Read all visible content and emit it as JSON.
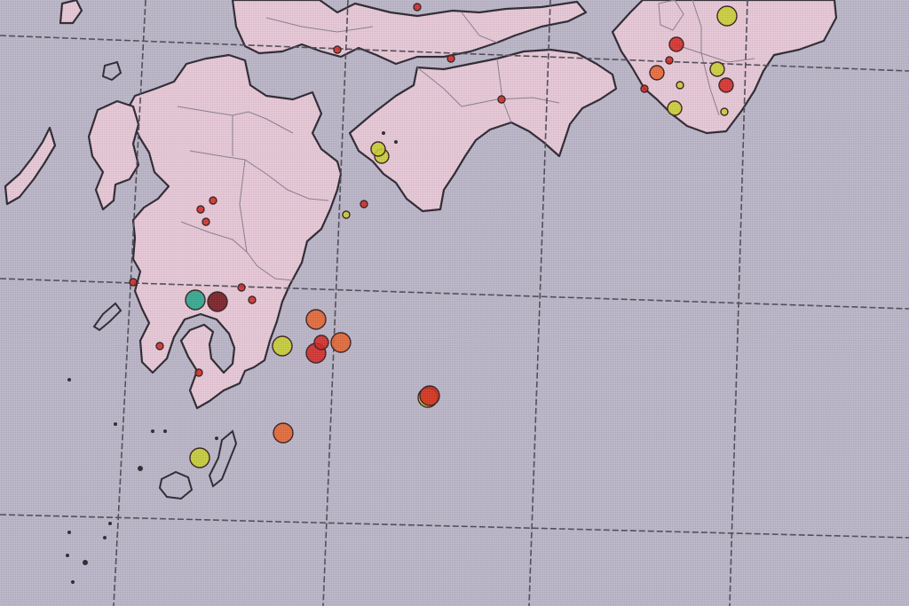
{
  "map": {
    "colors": {
      "sea": "#bcb7c9",
      "land": "#e9c9d8",
      "coast": "#2b2630",
      "grid": "#4e4a58",
      "quake_red": "#d6231e",
      "quake_orange": "#e8622a",
      "quake_yellow": "#c9d12a",
      "quake_cyan": "#1fa68a",
      "quake_darkred": "#6e0c12"
    },
    "markers": [
      {
        "id": "m1",
        "color": "quake_yellow",
        "size": "large"
      },
      {
        "id": "m2",
        "color": "quake_red",
        "size": "small"
      },
      {
        "id": "m3",
        "color": "quake_red",
        "size": "small"
      },
      {
        "id": "m4",
        "color": "quake_yellow",
        "size": "small"
      },
      {
        "id": "m5",
        "color": "quake_red",
        "size": "medium"
      },
      {
        "id": "m6",
        "color": "quake_yellow",
        "size": "medium"
      },
      {
        "id": "m7",
        "color": "quake_red",
        "size": "medium"
      },
      {
        "id": "m8",
        "color": "quake_orange",
        "size": "medium"
      },
      {
        "id": "m9",
        "color": "quake_yellow",
        "size": "medium"
      },
      {
        "id": "m10",
        "color": "quake_yellow",
        "size": "small"
      },
      {
        "id": "m11",
        "color": "quake_red",
        "size": "small"
      },
      {
        "id": "m12",
        "color": "quake_red",
        "size": "small"
      },
      {
        "id": "m13",
        "color": "quake_yellow",
        "size": "medium"
      },
      {
        "id": "m14",
        "color": "quake_yellow",
        "size": "medium"
      },
      {
        "id": "m15",
        "color": "quake_yellow",
        "size": "small"
      },
      {
        "id": "m16",
        "color": "quake_red",
        "size": "small"
      },
      {
        "id": "m17",
        "color": "quake_red",
        "size": "small"
      },
      {
        "id": "m18",
        "color": "quake_red",
        "size": "small"
      },
      {
        "id": "m19",
        "color": "quake_red",
        "size": "small"
      },
      {
        "id": "m20",
        "color": "quake_red",
        "size": "small"
      },
      {
        "id": "m21",
        "color": "quake_red",
        "size": "small"
      },
      {
        "id": "m22",
        "color": "quake_cyan",
        "size": "large"
      },
      {
        "id": "m23",
        "color": "quake_darkred",
        "size": "large"
      },
      {
        "id": "m24",
        "color": "quake_red",
        "size": "small"
      },
      {
        "id": "m25",
        "color": "quake_red",
        "size": "small"
      },
      {
        "id": "m26",
        "color": "quake_orange",
        "size": "large"
      },
      {
        "id": "m27",
        "color": "quake_red",
        "size": "large"
      },
      {
        "id": "m28",
        "color": "quake_red",
        "size": "medium"
      },
      {
        "id": "m29",
        "color": "quake_yellow",
        "size": "large"
      },
      {
        "id": "m30",
        "color": "quake_orange",
        "size": "large"
      },
      {
        "id": "m31",
        "color": "quake_yellow",
        "size": "large"
      },
      {
        "id": "m32",
        "color": "quake_red",
        "size": "large"
      },
      {
        "id": "m33",
        "color": "quake_orange",
        "size": "large"
      },
      {
        "id": "m34",
        "color": "quake_yellow",
        "size": "large"
      },
      {
        "id": "m35",
        "color": "quake_red",
        "size": "small"
      },
      {
        "id": "m36",
        "color": "quake_red",
        "size": "small"
      },
      {
        "id": "m37",
        "color": "quake_red",
        "size": "small"
      }
    ]
  }
}
